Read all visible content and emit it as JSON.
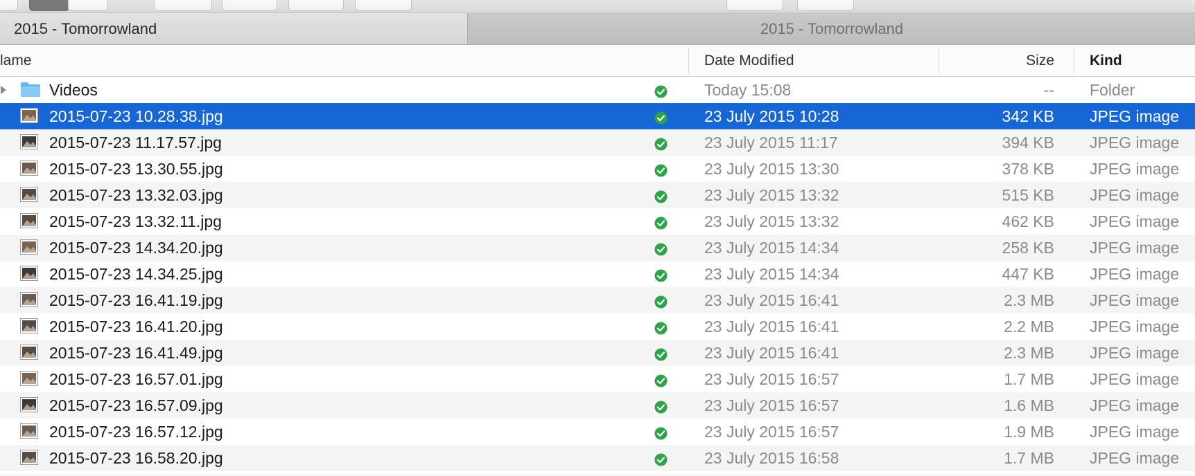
{
  "tabs": [
    {
      "label": "2015 - Tomorrowland",
      "active": true
    },
    {
      "label": "2015 - Tomorrowland",
      "active": false
    }
  ],
  "columns": {
    "name": "lame",
    "date": "Date Modified",
    "size": "Size",
    "kind": "Kind"
  },
  "colors": {
    "selection": "#1766d6",
    "sync_ok": "#2ea44a",
    "folder": "#6ab4ee"
  },
  "rows": [
    {
      "name": "Videos",
      "date": "Today 15:08",
      "size": "--",
      "kind": "Folder",
      "icon": "folder-icon",
      "status": "synced-check-icon",
      "expandable": true
    },
    {
      "name": "2015-07-23 10.28.38.jpg",
      "date": "23 July 2015 10:28",
      "size": "342 KB",
      "kind": "JPEG image",
      "icon": "image-thumbnail-icon",
      "status": "synced-check-icon",
      "selected": true
    },
    {
      "name": "2015-07-23 11.17.57.jpg",
      "date": "23 July 2015 11:17",
      "size": "394 KB",
      "kind": "JPEG image",
      "icon": "image-thumbnail-icon",
      "status": "synced-check-icon"
    },
    {
      "name": "2015-07-23 13.30.55.jpg",
      "date": "23 July 2015 13:30",
      "size": "378 KB",
      "kind": "JPEG image",
      "icon": "image-thumbnail-icon",
      "status": "synced-check-icon"
    },
    {
      "name": "2015-07-23 13.32.03.jpg",
      "date": "23 July 2015 13:32",
      "size": "515 KB",
      "kind": "JPEG image",
      "icon": "image-thumbnail-icon",
      "status": "synced-check-icon"
    },
    {
      "name": "2015-07-23 13.32.11.jpg",
      "date": "23 July 2015 13:32",
      "size": "462 KB",
      "kind": "JPEG image",
      "icon": "image-thumbnail-icon",
      "status": "synced-check-icon"
    },
    {
      "name": "2015-07-23 14.34.20.jpg",
      "date": "23 July 2015 14:34",
      "size": "258 KB",
      "kind": "JPEG image",
      "icon": "image-thumbnail-icon",
      "status": "synced-check-icon"
    },
    {
      "name": "2015-07-23 14.34.25.jpg",
      "date": "23 July 2015 14:34",
      "size": "447 KB",
      "kind": "JPEG image",
      "icon": "image-thumbnail-icon",
      "status": "synced-check-icon"
    },
    {
      "name": "2015-07-23 16.41.19.jpg",
      "date": "23 July 2015 16:41",
      "size": "2.3 MB",
      "kind": "JPEG image",
      "icon": "image-thumbnail-icon",
      "status": "synced-check-icon"
    },
    {
      "name": "2015-07-23 16.41.20.jpg",
      "date": "23 July 2015 16:41",
      "size": "2.2 MB",
      "kind": "JPEG image",
      "icon": "image-thumbnail-icon",
      "status": "synced-check-icon"
    },
    {
      "name": "2015-07-23 16.41.49.jpg",
      "date": "23 July 2015 16:41",
      "size": "2.3 MB",
      "kind": "JPEG image",
      "icon": "image-thumbnail-icon",
      "status": "synced-check-icon"
    },
    {
      "name": "2015-07-23 16.57.01.jpg",
      "date": "23 July 2015 16:57",
      "size": "1.7 MB",
      "kind": "JPEG image",
      "icon": "image-thumbnail-icon",
      "status": "synced-check-icon"
    },
    {
      "name": "2015-07-23 16.57.09.jpg",
      "date": "23 July 2015 16:57",
      "size": "1.6 MB",
      "kind": "JPEG image",
      "icon": "image-thumbnail-icon",
      "status": "synced-check-icon"
    },
    {
      "name": "2015-07-23 16.57.12.jpg",
      "date": "23 July 2015 16:57",
      "size": "1.9 MB",
      "kind": "JPEG image",
      "icon": "image-thumbnail-icon",
      "status": "synced-check-icon"
    },
    {
      "name": "2015-07-23 16.58.20.jpg",
      "date": "23 July 2015 16:58",
      "size": "1.7 MB",
      "kind": "JPEG image",
      "icon": "image-thumbnail-icon",
      "status": "synced-check-icon"
    }
  ]
}
